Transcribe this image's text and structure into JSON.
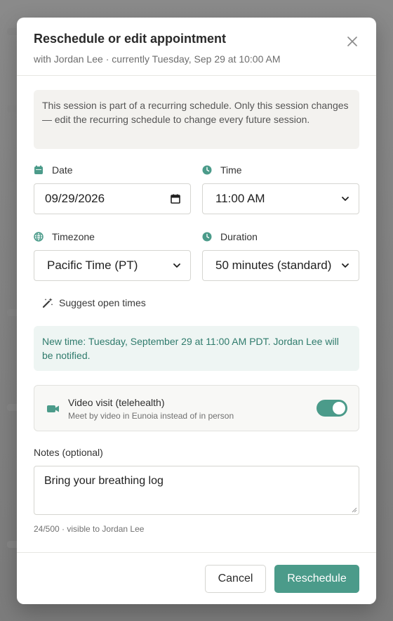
{
  "dialog": {
    "title": "Reschedule or edit appointment",
    "subtitle": "with Jordan Lee · currently Tuesday, Sep 29 at 10:00 AM",
    "close_icon": "close-icon"
  },
  "recurring_info": "This session is part of a recurring schedule. Only this session changes — edit the recurring schedule to change every future session.",
  "fields": {
    "date": {
      "label": "Date",
      "icon": "calendar-icon",
      "value": "09/29/2026"
    },
    "time": {
      "label": "Time",
      "icon": "clock-icon",
      "value": "11:00 AM"
    },
    "timezone": {
      "label": "Timezone",
      "icon": "globe-icon",
      "value": "Pacific Time (PT)"
    },
    "duration": {
      "label": "Duration",
      "icon": "clock-icon",
      "value": "50 minutes (standard)"
    }
  },
  "suggest_label": "Suggest open times",
  "notice": "New time: Tuesday, September 29 at 11:00 AM PDT. Jordan Lee will be notified.",
  "video": {
    "title": "Video visit (telehealth)",
    "subtitle": "Meet by video in Eunoia instead of in person",
    "enabled": true
  },
  "notes": {
    "label": "Notes (optional)",
    "value": "Bring your breathing log",
    "meta": "24/500 · visible to Jordan Lee"
  },
  "footer": {
    "cancel_label": "Cancel",
    "submit_label": "Reschedule"
  },
  "colors": {
    "accent": "#4b9b8a",
    "notice_text": "#2f7b6c",
    "notice_bg": "#eef5f3"
  }
}
